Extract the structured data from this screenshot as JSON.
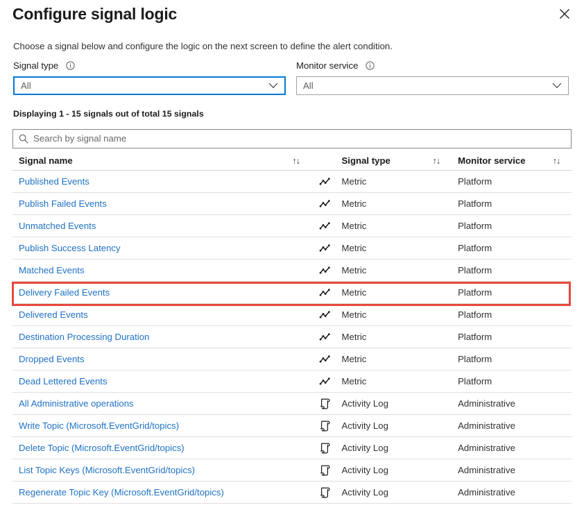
{
  "header": {
    "title": "Configure signal logic",
    "close_label": "Close",
    "subtitle": "Choose a signal below and configure the logic on the next screen to define the alert condition."
  },
  "filters": {
    "signal_type": {
      "label": "Signal type",
      "value": "All",
      "info_icon": "info-icon",
      "chevron_icon": "chevron-down-icon"
    },
    "monitor_service": {
      "label": "Monitor service",
      "value": "All",
      "info_icon": "info-icon",
      "chevron_icon": "chevron-down-icon"
    }
  },
  "results_summary": "Displaying 1 - 15 signals out of total 15 signals",
  "search": {
    "placeholder": "Search by signal name",
    "value": "",
    "icon": "search-icon"
  },
  "table": {
    "columns": [
      {
        "key": "name",
        "label": "Signal name",
        "sort_icon": "sort-arrows-icon"
      },
      {
        "key": "type",
        "label": "Signal type",
        "sort_icon": "sort-arrows-icon"
      },
      {
        "key": "service",
        "label": "Monitor service",
        "sort_icon": "sort-arrows-icon"
      }
    ],
    "rows": [
      {
        "name": "Published Events",
        "type": "Metric",
        "service": "Platform",
        "icon": "metric-line-chart-icon",
        "highlighted": false
      },
      {
        "name": "Publish Failed Events",
        "type": "Metric",
        "service": "Platform",
        "icon": "metric-line-chart-icon",
        "highlighted": false
      },
      {
        "name": "Unmatched Events",
        "type": "Metric",
        "service": "Platform",
        "icon": "metric-line-chart-icon",
        "highlighted": false
      },
      {
        "name": "Publish Success Latency",
        "type": "Metric",
        "service": "Platform",
        "icon": "metric-line-chart-icon",
        "highlighted": false
      },
      {
        "name": "Matched Events",
        "type": "Metric",
        "service": "Platform",
        "icon": "metric-line-chart-icon",
        "highlighted": false
      },
      {
        "name": "Delivery Failed Events",
        "type": "Metric",
        "service": "Platform",
        "icon": "metric-line-chart-icon",
        "highlighted": true
      },
      {
        "name": "Delivered Events",
        "type": "Metric",
        "service": "Platform",
        "icon": "metric-line-chart-icon",
        "highlighted": false
      },
      {
        "name": "Destination Processing Duration",
        "type": "Metric",
        "service": "Platform",
        "icon": "metric-line-chart-icon",
        "highlighted": false
      },
      {
        "name": "Dropped Events",
        "type": "Metric",
        "service": "Platform",
        "icon": "metric-line-chart-icon",
        "highlighted": false
      },
      {
        "name": "Dead Lettered Events",
        "type": "Metric",
        "service": "Platform",
        "icon": "metric-line-chart-icon",
        "highlighted": false
      },
      {
        "name": "All Administrative operations",
        "type": "Activity Log",
        "service": "Administrative",
        "icon": "activity-log-scroll-icon",
        "highlighted": false
      },
      {
        "name": "Write Topic (Microsoft.EventGrid/topics)",
        "type": "Activity Log",
        "service": "Administrative",
        "icon": "activity-log-scroll-icon",
        "highlighted": false
      },
      {
        "name": "Delete Topic (Microsoft.EventGrid/topics)",
        "type": "Activity Log",
        "service": "Administrative",
        "icon": "activity-log-scroll-icon",
        "highlighted": false
      },
      {
        "name": "List Topic Keys (Microsoft.EventGrid/topics)",
        "type": "Activity Log",
        "service": "Administrative",
        "icon": "activity-log-scroll-icon",
        "highlighted": false
      },
      {
        "name": "Regenerate Topic Key (Microsoft.EventGrid/topics)",
        "type": "Activity Log",
        "service": "Administrative",
        "icon": "activity-log-scroll-icon",
        "highlighted": false
      }
    ]
  },
  "annotation": {
    "highlight_color": "#e8483c",
    "highlighted_row": "Delivery Failed Events"
  },
  "colors": {
    "link": "#1f72c4",
    "focus_border": "#0078d4",
    "text": "#323130",
    "highlight": "#e8483c"
  },
  "sort_glyph": "↑↓"
}
